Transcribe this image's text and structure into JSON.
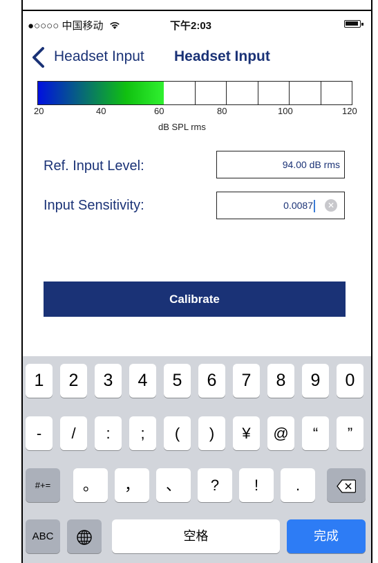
{
  "status": {
    "carrier": "●○○○○ 中国移动",
    "wifi": "wifi-icon",
    "time": "下午2:03",
    "battery": "battery-icon"
  },
  "nav": {
    "back_label": "Headset Input",
    "title": "Headset Input"
  },
  "meter": {
    "ticks": [
      "20",
      "40",
      "60",
      "80",
      "100",
      "120"
    ],
    "unit": "dB SPL rms",
    "level_db": 60,
    "colors": {
      "low": "#0010e0",
      "mid": "#10c010",
      "high": "#30f030"
    }
  },
  "form": {
    "ref_label": "Ref. Input Level:",
    "ref_value": "94.00 dB rms",
    "sens_label": "Input Sensitivity:",
    "sens_value": "0.0087"
  },
  "button": {
    "calibrate": "Calibrate"
  },
  "keyboard": {
    "row1": [
      "1",
      "2",
      "3",
      "4",
      "5",
      "6",
      "7",
      "8",
      "9",
      "0"
    ],
    "row2": [
      "-",
      "/",
      ":",
      ";",
      "(",
      ")",
      "¥",
      "@",
      "“",
      "”"
    ],
    "row3": [
      "#+=",
      "。",
      "，",
      "、",
      "?",
      "!",
      "."
    ],
    "row4": {
      "abc": "ABC",
      "space": "空格",
      "done": "完成"
    }
  },
  "colors": {
    "accent": "#1a3276",
    "done": "#2d7cf5"
  }
}
